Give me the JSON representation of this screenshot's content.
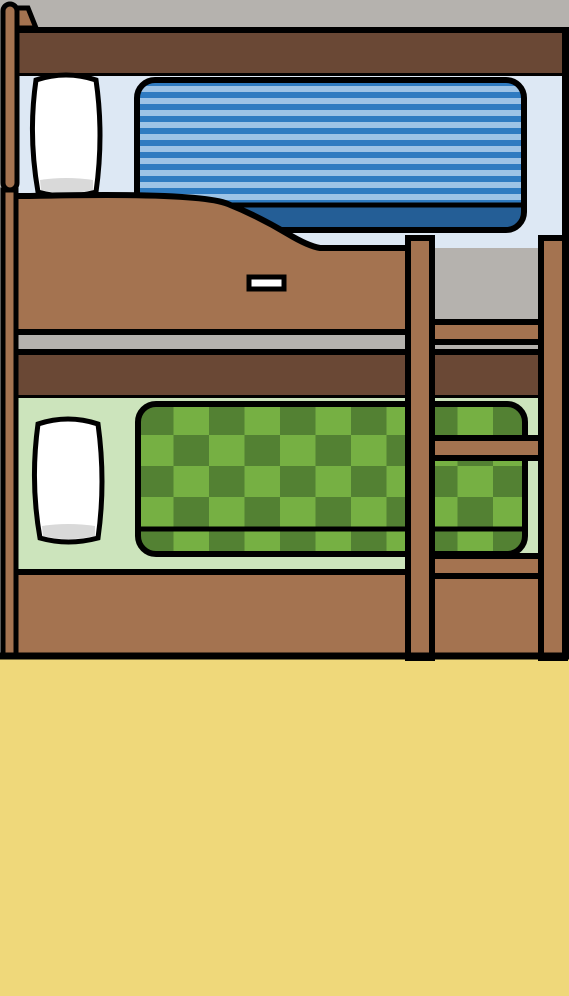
{
  "scene": {
    "name": "bunk-bed-room",
    "objects": [
      {
        "name": "top-bunk",
        "blanket_pattern": "blue-stripes"
      },
      {
        "name": "bottom-bunk",
        "blanket_pattern": "green-checkerboard"
      },
      {
        "name": "ladder"
      },
      {
        "name": "top-pillow"
      },
      {
        "name": "bottom-pillow"
      },
      {
        "name": "floor"
      }
    ]
  },
  "colors": {
    "wall": "#B5B2AE",
    "floor": "#EFD87A",
    "wood": "#A47350",
    "wood_dark": "#6A4835",
    "outline": "#000000",
    "top_sheet": "#DDE8F4",
    "bottom_sheet": "#CCE4BC",
    "blue_stripe_light": "#9DC3E6",
    "blue_stripe_mid": "#2F7BC1",
    "blue_dark": "#245E96",
    "green_light": "#76B043",
    "green_dark": "#538133",
    "pillow": "#FFFFFF",
    "pillow_shadow": "#D9D9D9"
  }
}
